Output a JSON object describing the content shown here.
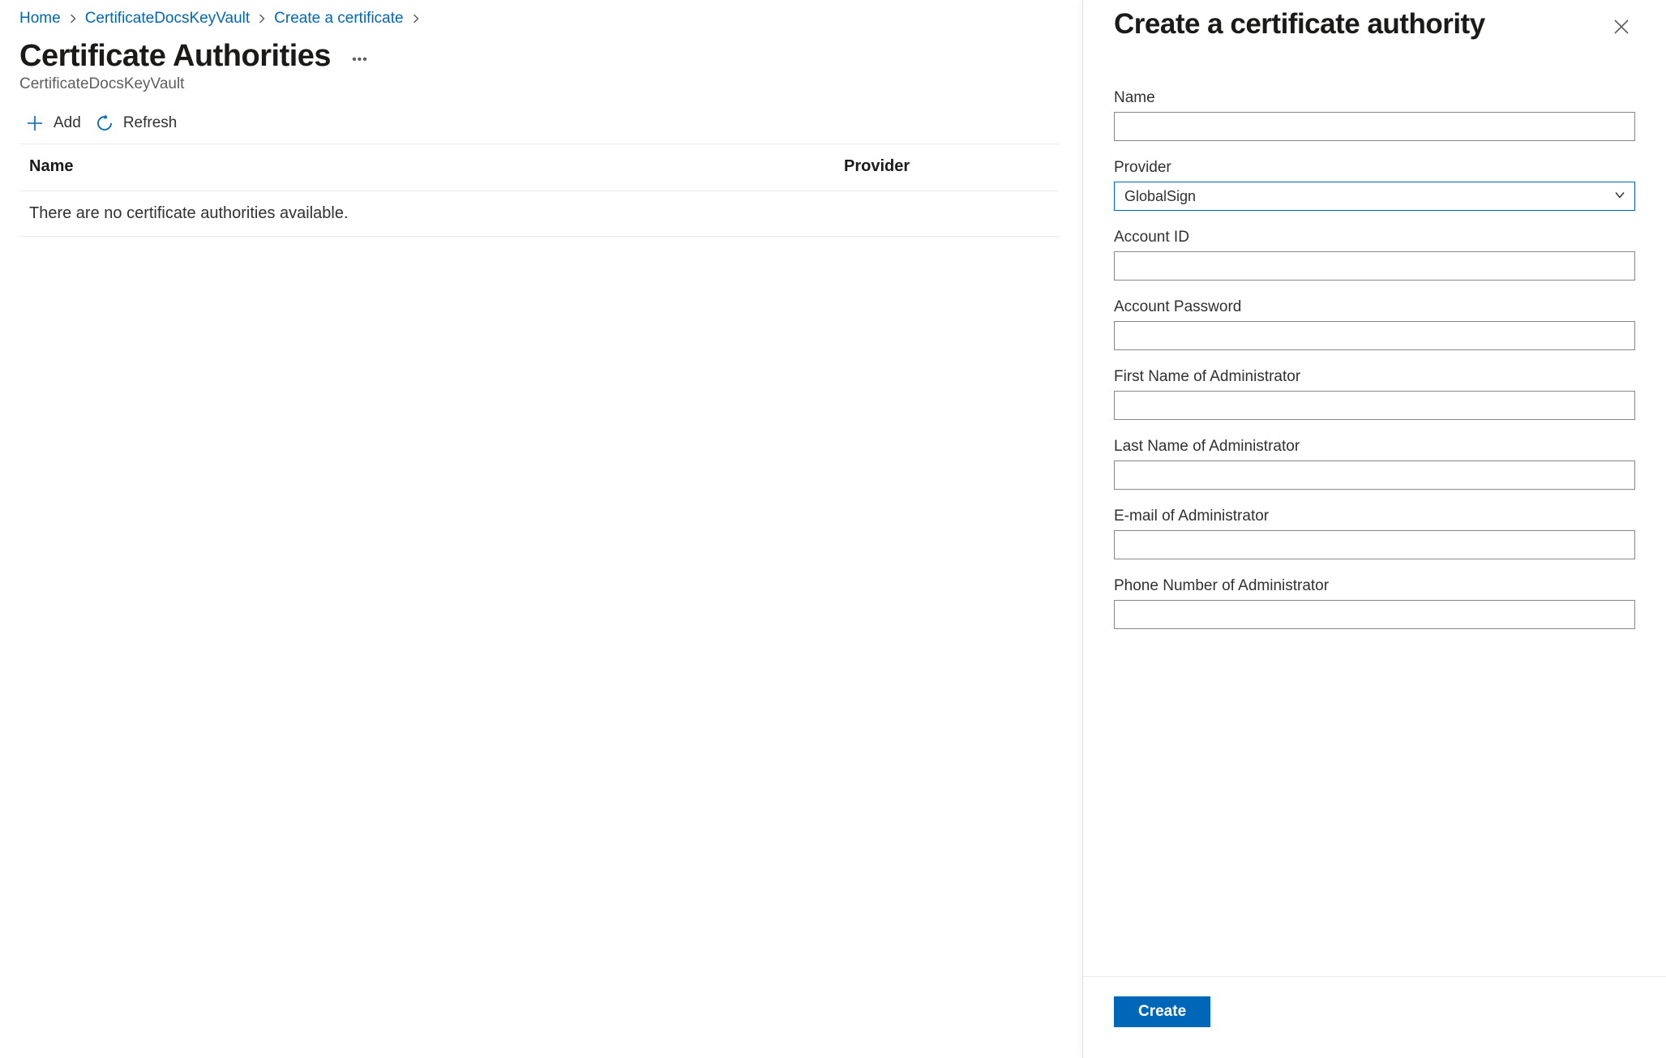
{
  "breadcrumb": {
    "items": [
      {
        "label": "Home"
      },
      {
        "label": "CertificateDocsKeyVault"
      },
      {
        "label": "Create a certificate"
      }
    ]
  },
  "page": {
    "title": "Certificate Authorities",
    "subtitle": "CertificateDocsKeyVault"
  },
  "toolbar": {
    "add_label": "Add",
    "refresh_label": "Refresh"
  },
  "table": {
    "col_name": "Name",
    "col_provider": "Provider",
    "empty_message": "There are no certificate authorities available."
  },
  "panel": {
    "title": "Create a certificate authority",
    "fields": {
      "name_label": "Name",
      "name_value": "",
      "provider_label": "Provider",
      "provider_value": "GlobalSign",
      "account_id_label": "Account ID",
      "account_id_value": "",
      "account_password_label": "Account Password",
      "account_password_value": "",
      "first_name_label": "First Name of Administrator",
      "first_name_value": "",
      "last_name_label": "Last Name of Administrator",
      "last_name_value": "",
      "email_label": "E-mail of Administrator",
      "email_value": "",
      "phone_label": "Phone Number of Administrator",
      "phone_value": ""
    },
    "create_label": "Create"
  }
}
